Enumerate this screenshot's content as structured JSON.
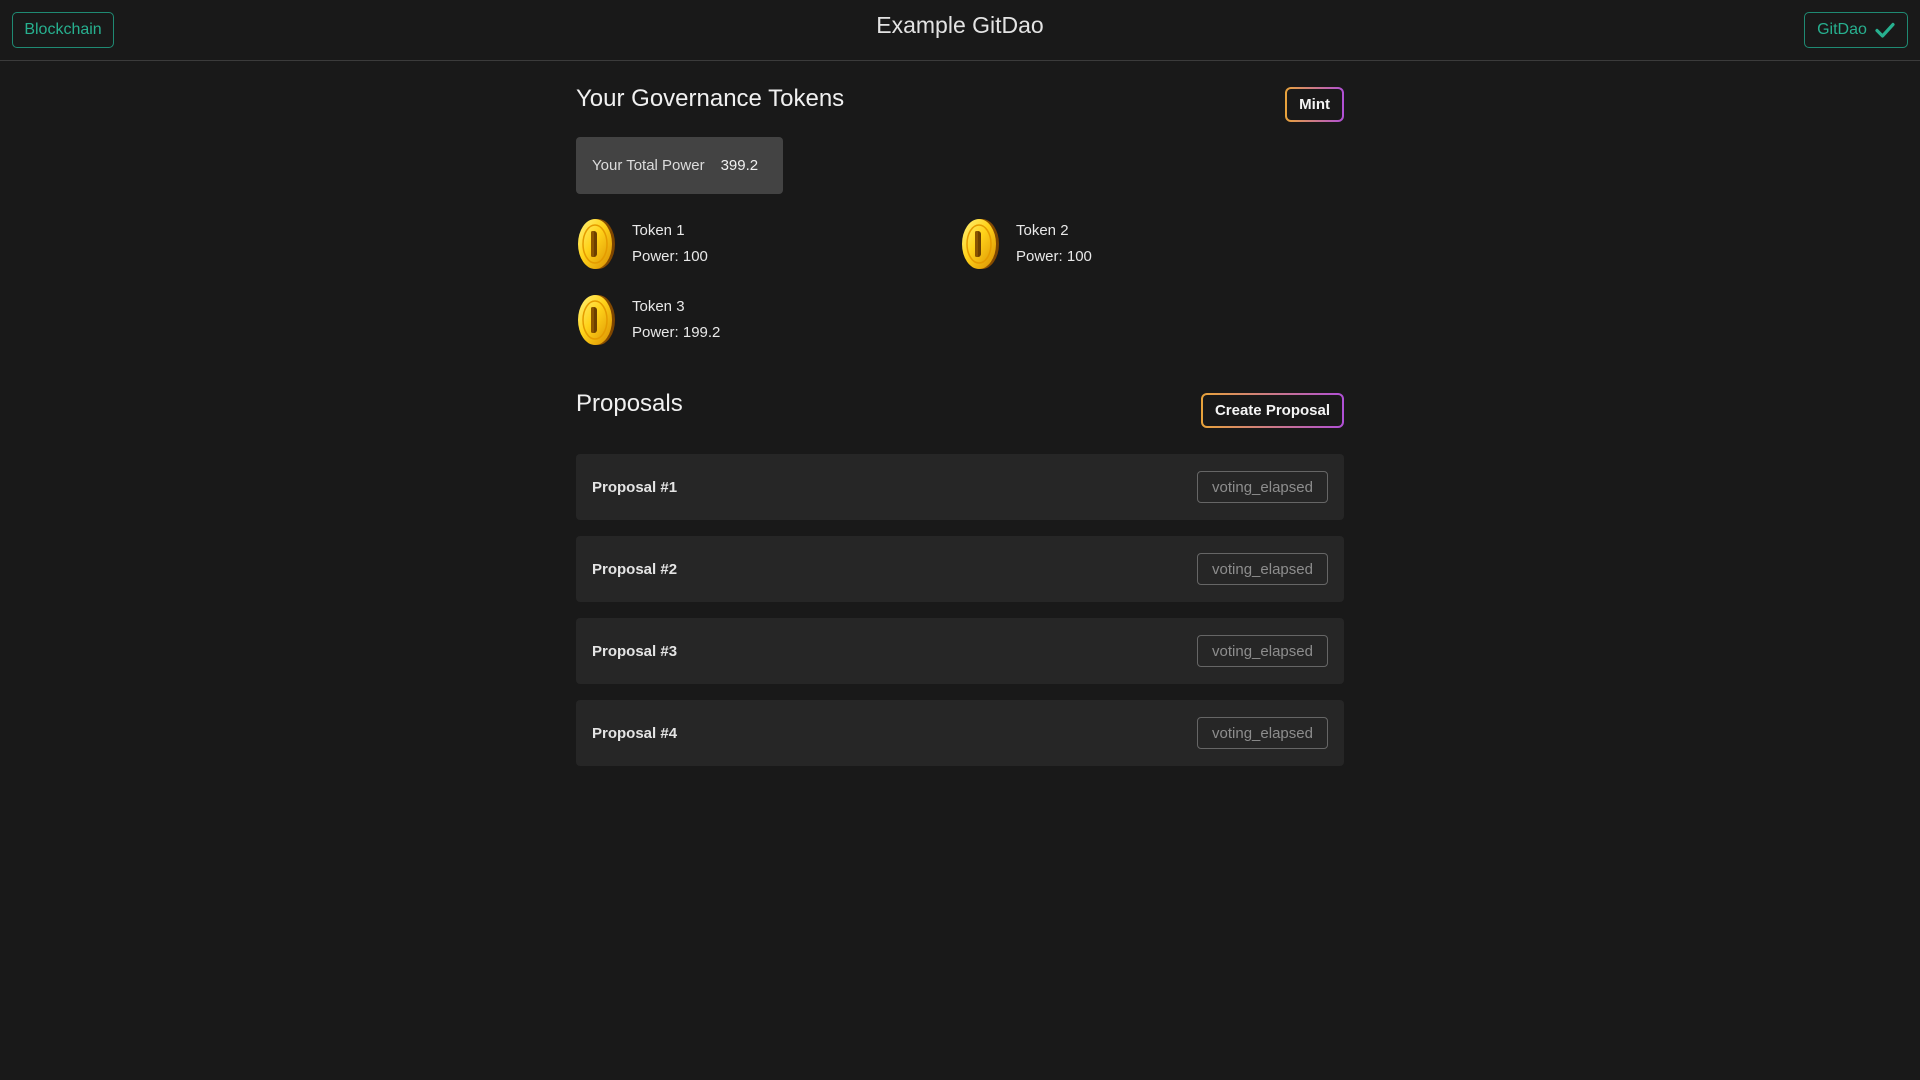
{
  "header": {
    "blockchain_label": "Blockchain",
    "title": "Example GitDao",
    "gitdao_label": "GitDao",
    "accent_color": "#27b08f"
  },
  "tokens": {
    "heading": "Your Governance Tokens",
    "mint_label": "Mint",
    "total_power_label": "Your Total Power",
    "total_power_value": "399.2",
    "items": [
      {
        "name": "Token 1",
        "power": "Power: 100",
        "icon": "coin-icon"
      },
      {
        "name": "Token 2",
        "power": "Power: 100",
        "icon": "coin-icon"
      },
      {
        "name": "Token 3",
        "power": "Power: 199.2",
        "icon": "coin-icon"
      }
    ]
  },
  "proposals": {
    "heading": "Proposals",
    "create_label": "Create Proposal",
    "items": [
      {
        "name": "Proposal #1",
        "status": "voting_elapsed"
      },
      {
        "name": "Proposal #2",
        "status": "voting_elapsed"
      },
      {
        "name": "Proposal #3",
        "status": "voting_elapsed"
      },
      {
        "name": "Proposal #4",
        "status": "voting_elapsed"
      }
    ]
  }
}
